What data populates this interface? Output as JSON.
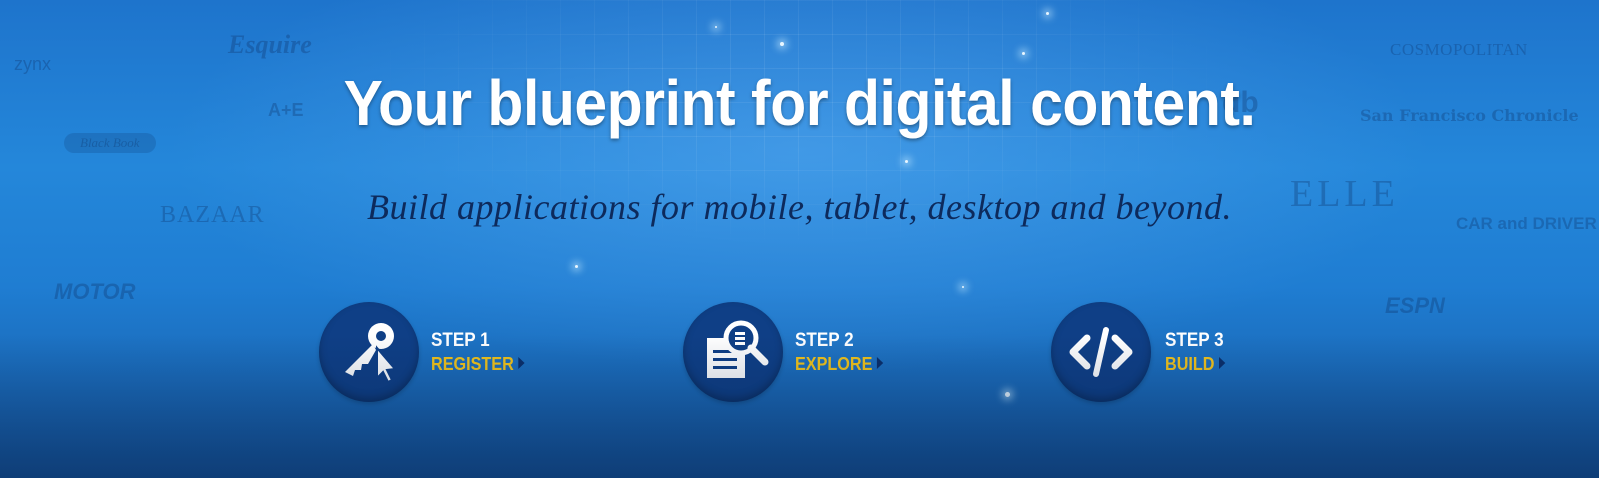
{
  "hero": {
    "headline": "Your blueprint for digital content.",
    "subheadline": "Build applications for mobile, tablet, desktop and beyond."
  },
  "background_logos": [
    "Esquire",
    "zynx",
    "A+E",
    "Black Book",
    "BAZAAR",
    "MOTOR",
    "COSMOPOLITAN",
    "db",
    "San Francisco Chronicle",
    "ELLE",
    "CAR and DRIVER",
    "ESPN"
  ],
  "steps": [
    {
      "number": "STEP 1",
      "label": "REGISTER",
      "icon": "key-cursor-icon"
    },
    {
      "number": "STEP 2",
      "label": "EXPLORE",
      "icon": "document-magnifier-icon"
    },
    {
      "number": "STEP 3",
      "label": "BUILD",
      "icon": "code-brackets-icon"
    }
  ],
  "colors": {
    "background": "#1f7dd2",
    "headline": "#ffffff",
    "subheadline": "#0d2a5c",
    "step_circle": "#0f3f86",
    "step_link": "#f4c51a"
  }
}
